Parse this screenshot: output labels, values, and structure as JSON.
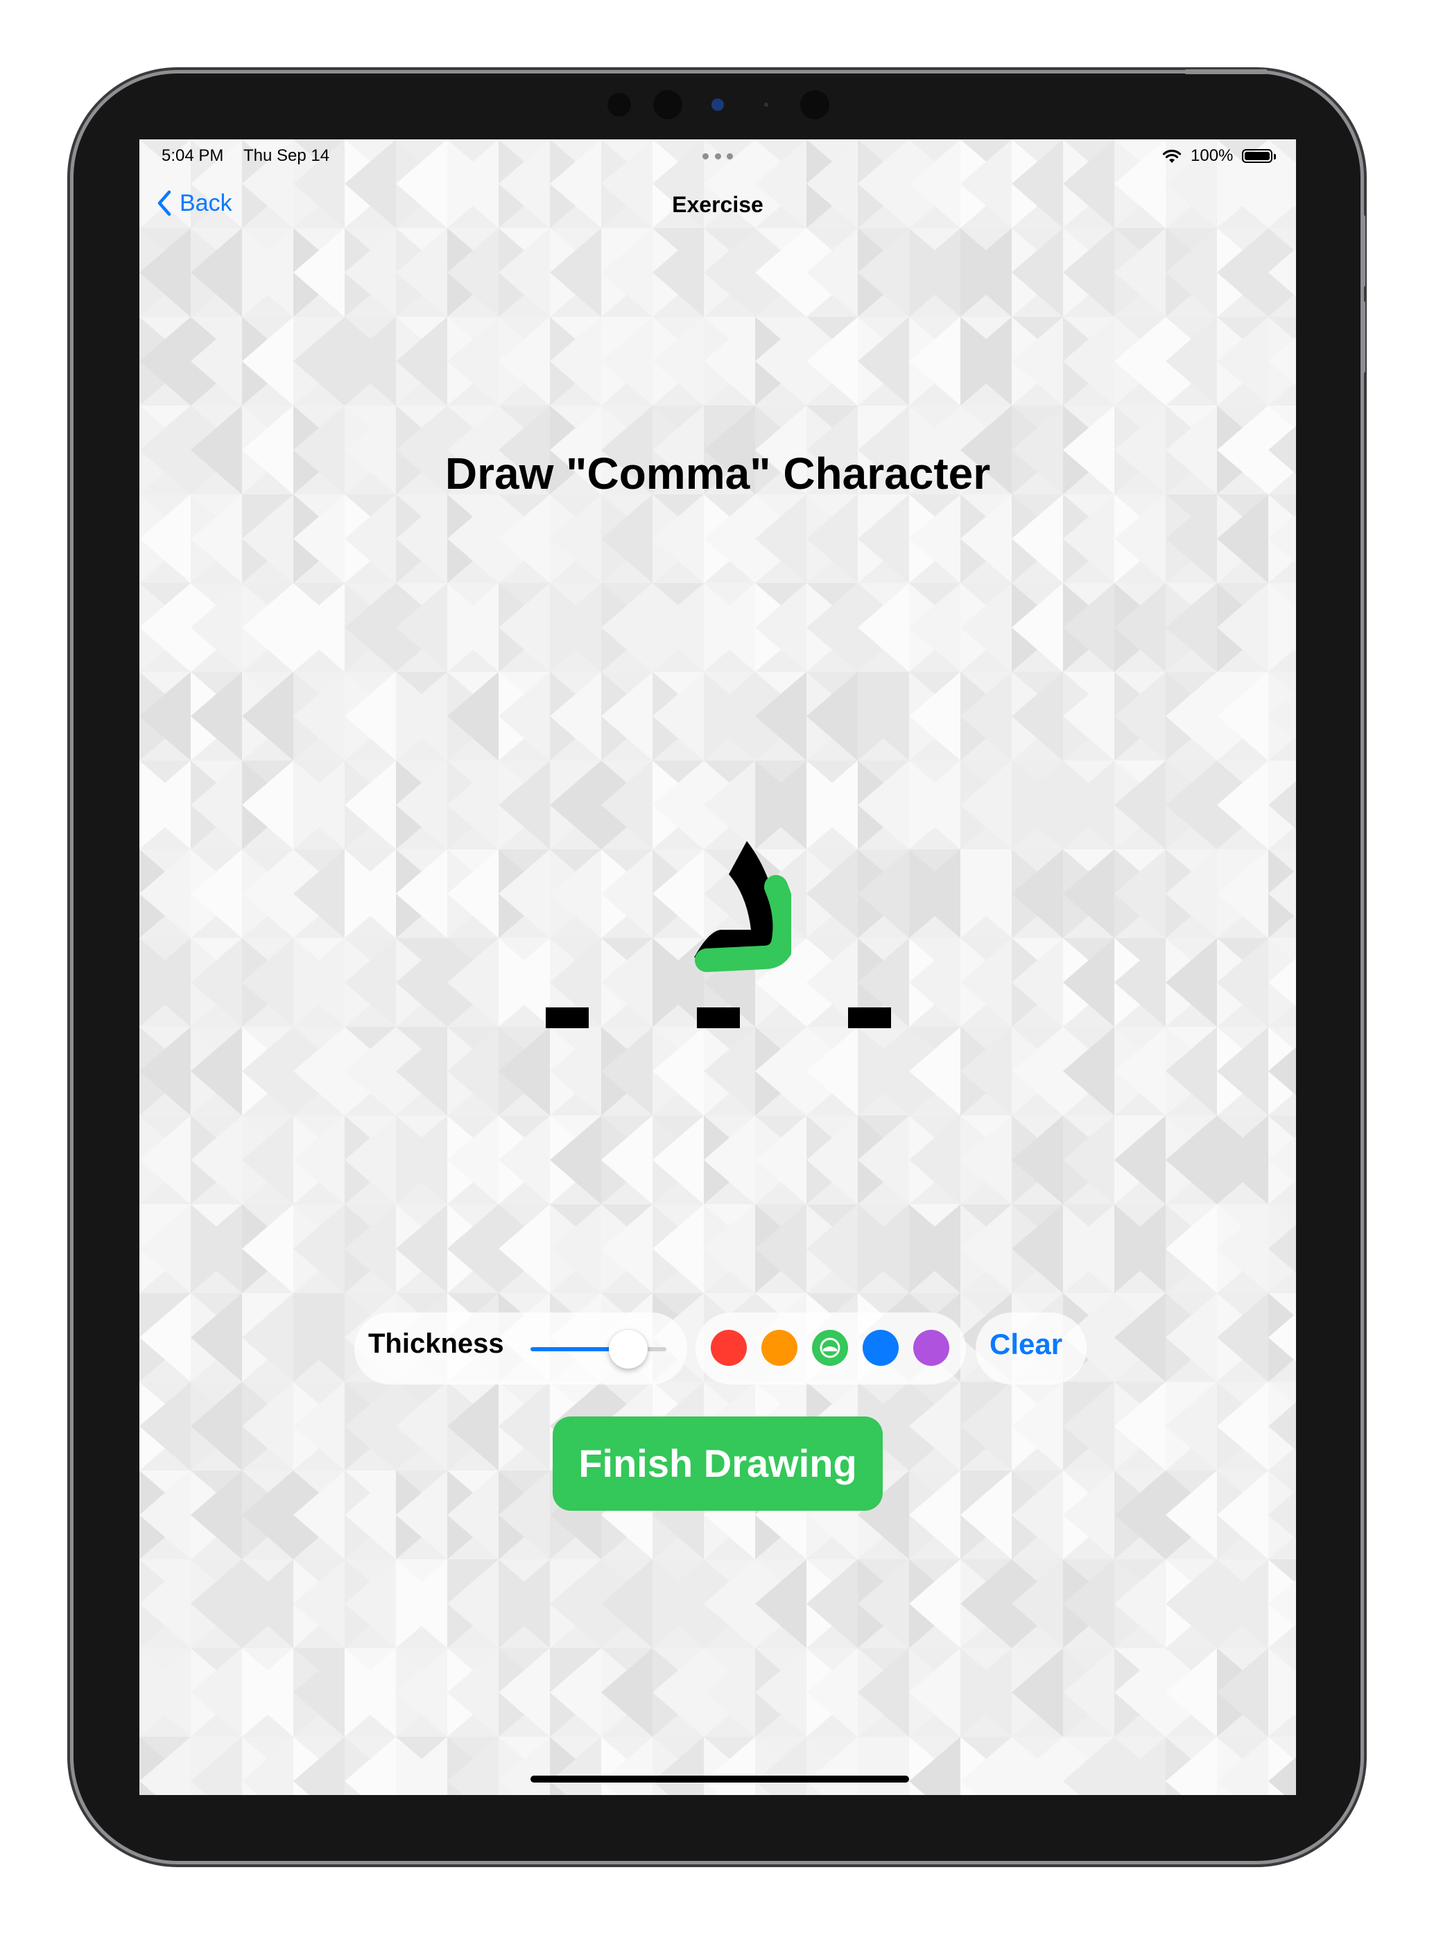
{
  "status_bar": {
    "time": "5:04 PM",
    "date": "Thu Sep 14",
    "battery": "100%"
  },
  "nav": {
    "back_label": "Back",
    "title": "Exercise"
  },
  "exercise": {
    "heading": "Draw \"Comma\" Character",
    "character": "د"
  },
  "toolbar": {
    "thickness_label": "Thickness",
    "thickness_value": 0.72,
    "colors": [
      "#ff3b30",
      "#ff9500",
      "#34c759",
      "#0a7aff",
      "#af52de"
    ],
    "selected_color": "#34c759",
    "clear_label": "Clear"
  },
  "finish_label": "Finish Drawing",
  "accent_color": "#0a7aff"
}
